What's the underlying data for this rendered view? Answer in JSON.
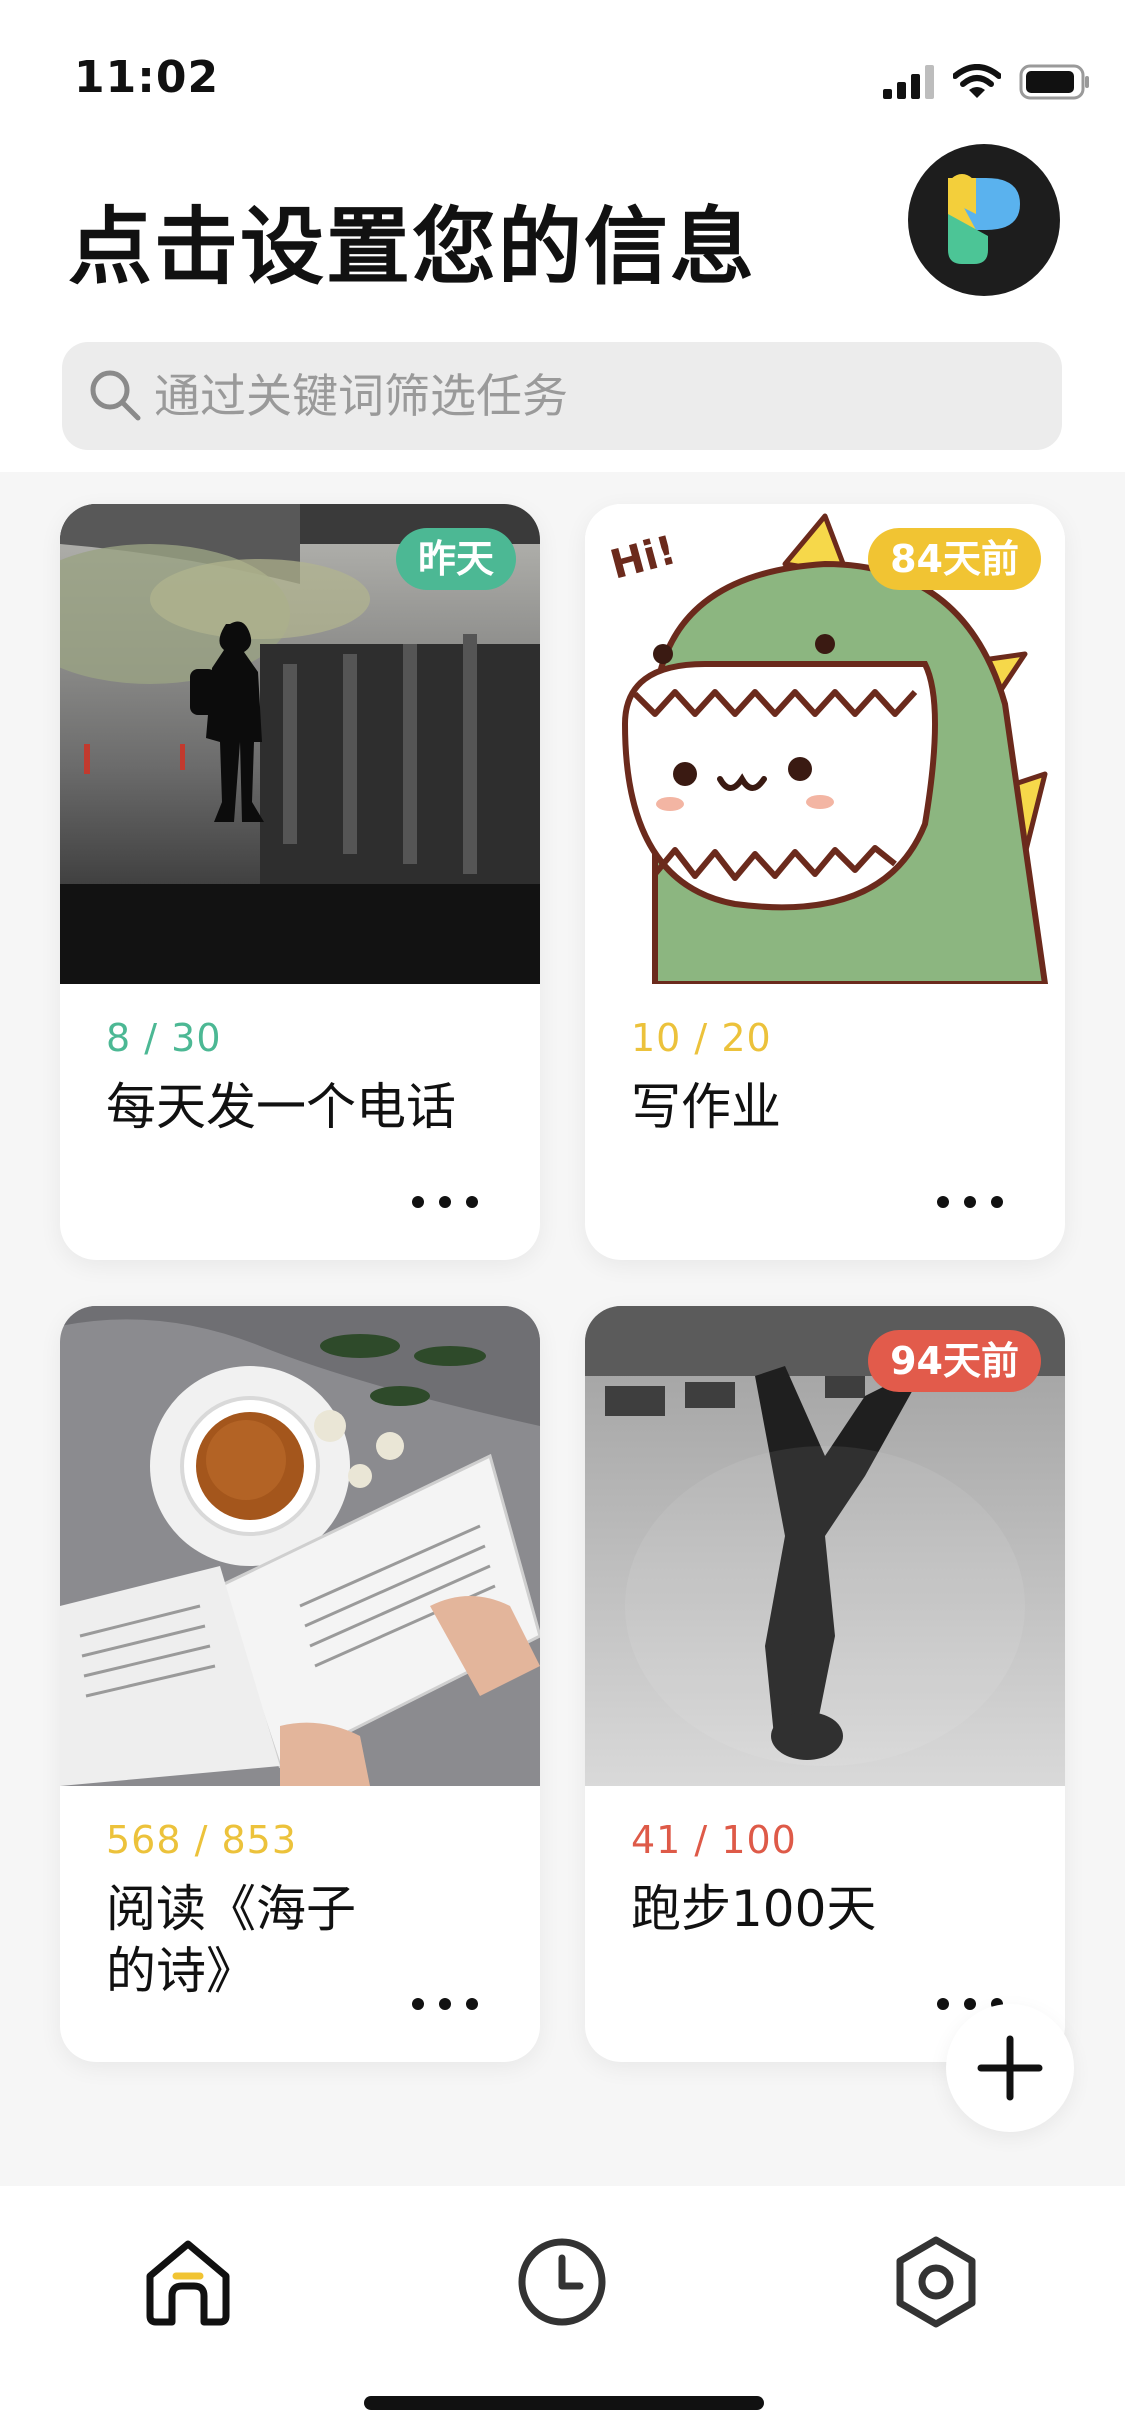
{
  "status_bar": {
    "time": "11:02"
  },
  "header": {
    "title": "点击设置您的信息"
  },
  "search": {
    "placeholder": "通过关键词筛选任务",
    "value": ""
  },
  "cards": [
    {
      "badge": "昨天",
      "badge_color": "#4cb894",
      "progress": "8 / 30",
      "progress_color": "#4cb894",
      "title": "每天发一个电话",
      "image": "silhouette-under-bridge-photo"
    },
    {
      "badge": "84天前",
      "badge_color": "#f1c433",
      "progress": "10 / 20",
      "progress_color": "#ecc23b",
      "title": "写作业",
      "image": "green-dinosaur-illustration"
    },
    {
      "badge": "",
      "badge_color": "",
      "progress": "568 / 853",
      "progress_color": "#ecc23b",
      "title": "阅读《海子的诗》",
      "image": "book-and-tea-photo"
    },
    {
      "badge": "94天前",
      "badge_color": "#e25b4b",
      "progress": "41 / 100",
      "progress_color": "#de5a48",
      "title": "跑步100天",
      "image": "puddle-reflection-photo"
    }
  ],
  "fab": {
    "icon": "plus-icon"
  },
  "tab_bar": {
    "items": [
      {
        "icon": "home-icon",
        "active": true
      },
      {
        "icon": "clock-icon",
        "active": false
      },
      {
        "icon": "settings-hexagon-icon",
        "active": false
      }
    ]
  },
  "colors": {
    "accent_green": "#4cb894",
    "accent_yellow": "#f1c433",
    "accent_red": "#e25b4b",
    "search_bg": "#ececec",
    "content_bg": "#f6f6f6"
  }
}
